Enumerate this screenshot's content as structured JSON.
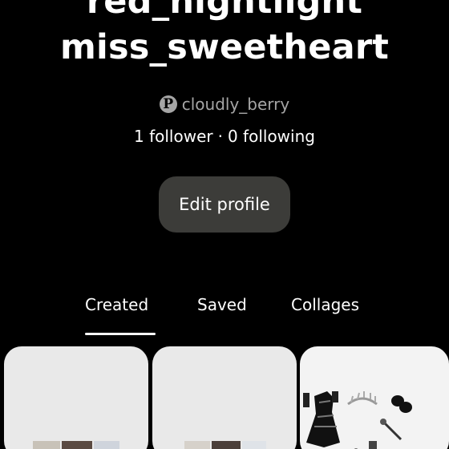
{
  "profile": {
    "name_line_1": "red_nightlight",
    "name_line_2": "miss_sweetheart",
    "handle": "cloudly_berry",
    "pinterest_glyph": "P",
    "followers_text": "1 follower",
    "separator": "·",
    "following_text": "0 following",
    "edit_button_label": "Edit profile"
  },
  "tabs": [
    {
      "label": "Created",
      "active": true
    },
    {
      "label": "Saved",
      "active": false
    },
    {
      "label": "Collages",
      "active": false
    }
  ],
  "icons": {
    "handle_icon": "pinterest-logo-icon"
  },
  "colors": {
    "background": "#000000",
    "button_bg": "#3c3c39",
    "muted_text": "#a5a5a5",
    "card_bg": "#e9e9e9"
  }
}
